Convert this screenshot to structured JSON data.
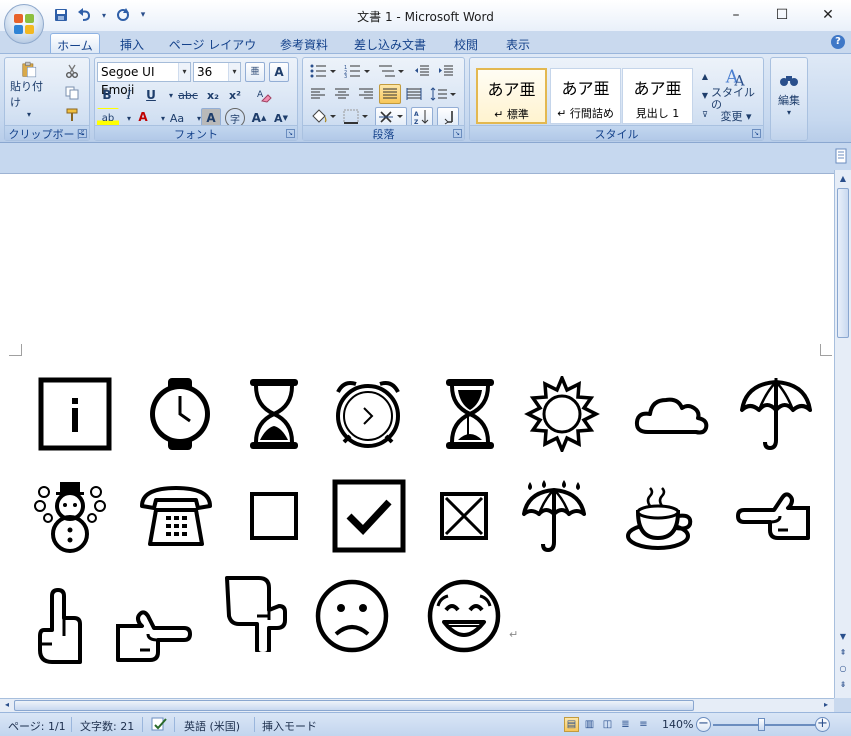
{
  "window": {
    "title": "文書 1 - Microsoft Word",
    "controls": {
      "minimize": "–",
      "maximize": "☐",
      "close": "✕"
    }
  },
  "quick_access": {
    "save_icon": "save-icon",
    "undo_icon": "undo-icon",
    "redo_icon": "redo-icon",
    "customize": "▾"
  },
  "tabs": [
    {
      "label": "ホーム",
      "active": true
    },
    {
      "label": "挿入"
    },
    {
      "label": "ページ レイアウト"
    },
    {
      "label": "参考資料"
    },
    {
      "label": "差し込み文書"
    },
    {
      "label": "校閲"
    },
    {
      "label": "表示"
    }
  ],
  "ribbon": {
    "clipboard": {
      "label": "クリップボード",
      "paste_label": "貼り付け",
      "paste_arrow": "▾"
    },
    "font": {
      "label": "フォント",
      "font_name": "Segoe UI Emoji",
      "font_size": "36",
      "bold": "B",
      "italic": "I",
      "underline": "U",
      "strike": "abc",
      "subscript": "x₂",
      "superscript": "x²",
      "change_case": "Aa",
      "char_shading": "A",
      "enclose": "字",
      "grow": "A",
      "shrink": "A",
      "highlight": "ab",
      "font_color": "A",
      "phonetic": "亜",
      "char_border": "A"
    },
    "paragraph": {
      "label": "段落"
    },
    "styles": {
      "label": "スタイル",
      "items": [
        {
          "sample": "あア亜",
          "name": "↵ 標準",
          "selected": true
        },
        {
          "sample": "あア亜",
          "name": "↵ 行間詰め"
        },
        {
          "sample": "あア亜",
          "name": "見出し 1"
        }
      ],
      "change_label_1": "スタイルの",
      "change_label_2": "変更 ▾"
    },
    "editing": {
      "label": "編集"
    }
  },
  "document": {
    "paragraph_mark": "↵",
    "glyphs": [
      "information-source",
      "watch",
      "hourglass-done",
      "alarm-clock",
      "hourglass-flowing",
      "sun",
      "cloud",
      "umbrella",
      "snowman",
      "telephone",
      "white-square",
      "check-box",
      "ballot-x",
      "umbrella-rain",
      "hot-beverage",
      "backhand-left",
      "index-pointing-up",
      "backhand-right",
      "backhand-down",
      "frowning-face",
      "smiling-face"
    ]
  },
  "statusbar": {
    "page": "ページ: 1/1",
    "words": "文字数: 21",
    "language": "英語 (米国)",
    "mode": "挿入モード",
    "zoom": "140%",
    "zoom_level": 140
  }
}
